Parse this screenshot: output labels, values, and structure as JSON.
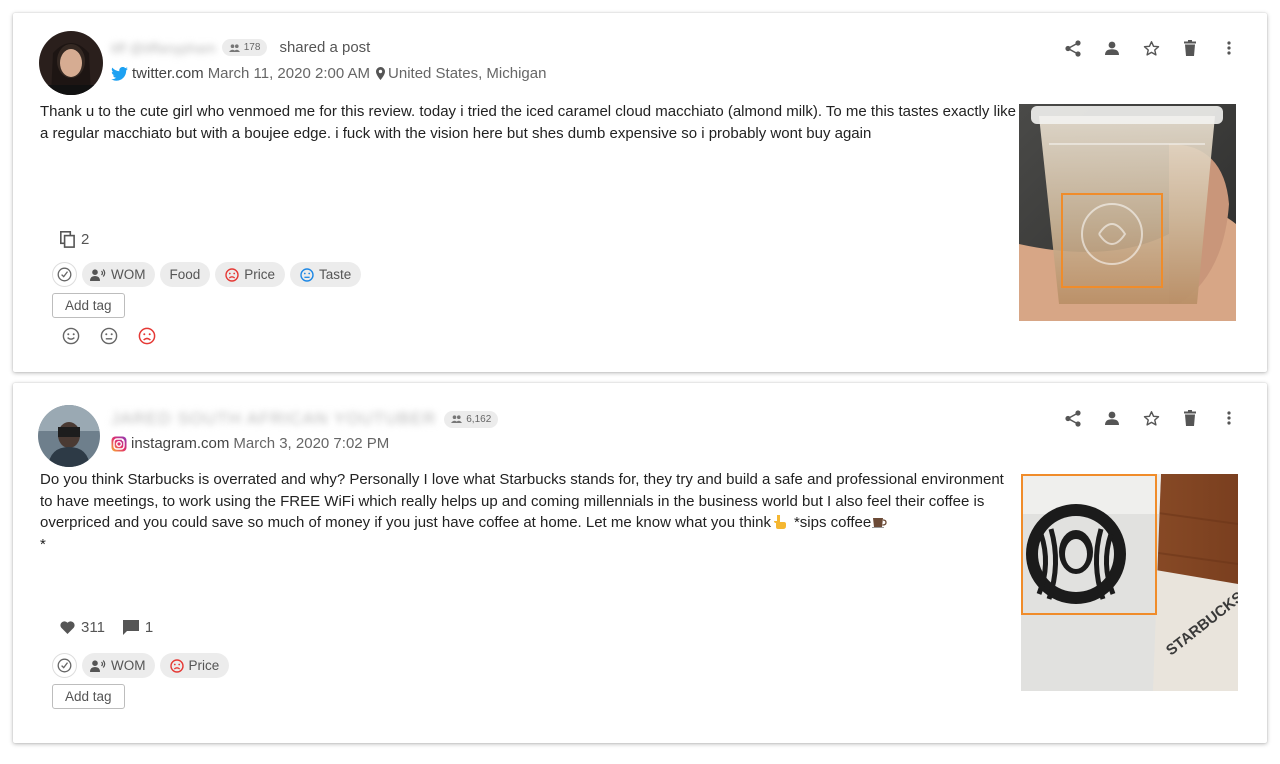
{
  "posts": [
    {
      "author_name": "tiff @tiffanypham",
      "followers": "178",
      "action_text": "shared a post",
      "source": {
        "domain": "twitter.com",
        "icon": "twitter-icon",
        "color": "#1da1f2"
      },
      "date": "March 11, 2020 2:00 AM",
      "location": "United States, Michigan",
      "text": "Thank u to the cute girl who venmoed me for this review. today i tried the iced caramel cloud macchiato (almond milk). To me this tastes exactly like a regular macchiato but with a boujee edge. i fuck with the vision here but shes dumb expensive so i probably wont buy again",
      "actions": [
        "share-icon",
        "person-icon",
        "star-icon",
        "delete-icon",
        "more-icon"
      ],
      "stats": {
        "copies": "2"
      },
      "tags": [
        {
          "icon": "check-circle-icon"
        },
        {
          "label": "WOM",
          "icon": "wom-icon"
        },
        {
          "label": "Food"
        },
        {
          "label": "Price",
          "icon": "negative-face-icon",
          "color": "#e53935"
        },
        {
          "label": "Taste",
          "icon": "neutral-face-icon",
          "color": "#1e88e5"
        }
      ],
      "add_tag_label": "Add tag",
      "sentiments": [
        "positive",
        "neutral",
        "negative"
      ],
      "sentiment_selected_color": "#e53935",
      "image_box_color": "#f08c2a"
    },
    {
      "author_name": "JARED SOUTH AFRICAN YOUTUBER",
      "followers": "6,162",
      "source": {
        "domain": "instagram.com",
        "icon": "instagram-icon",
        "color": "#d6249f"
      },
      "date": "March 3, 2020 7:02 PM",
      "text_main": "Do you think Starbucks is overrated and why? Personally I love what Starbucks stands for, they try and build a safe and professional environment to have meetings, to work using the FREE WiFi which really helps up and coming millennials in the business world but I also feel their coffee is overpriced and you could save so much of money if you just have coffee at home. Let me know what you think",
      "text_sips": "*sips coffee",
      "text_end": "*",
      "actions": [
        "share-icon",
        "person-icon",
        "star-icon",
        "delete-icon",
        "more-icon"
      ],
      "stats": {
        "likes": "311",
        "comments": "1"
      },
      "tags": [
        {
          "icon": "check-circle-icon"
        },
        {
          "label": "WOM",
          "icon": "wom-icon"
        },
        {
          "label": "Price",
          "icon": "negative-face-icon",
          "color": "#e53935"
        }
      ],
      "add_tag_label": "Add tag",
      "image_box_color": "#f08c2a"
    }
  ]
}
